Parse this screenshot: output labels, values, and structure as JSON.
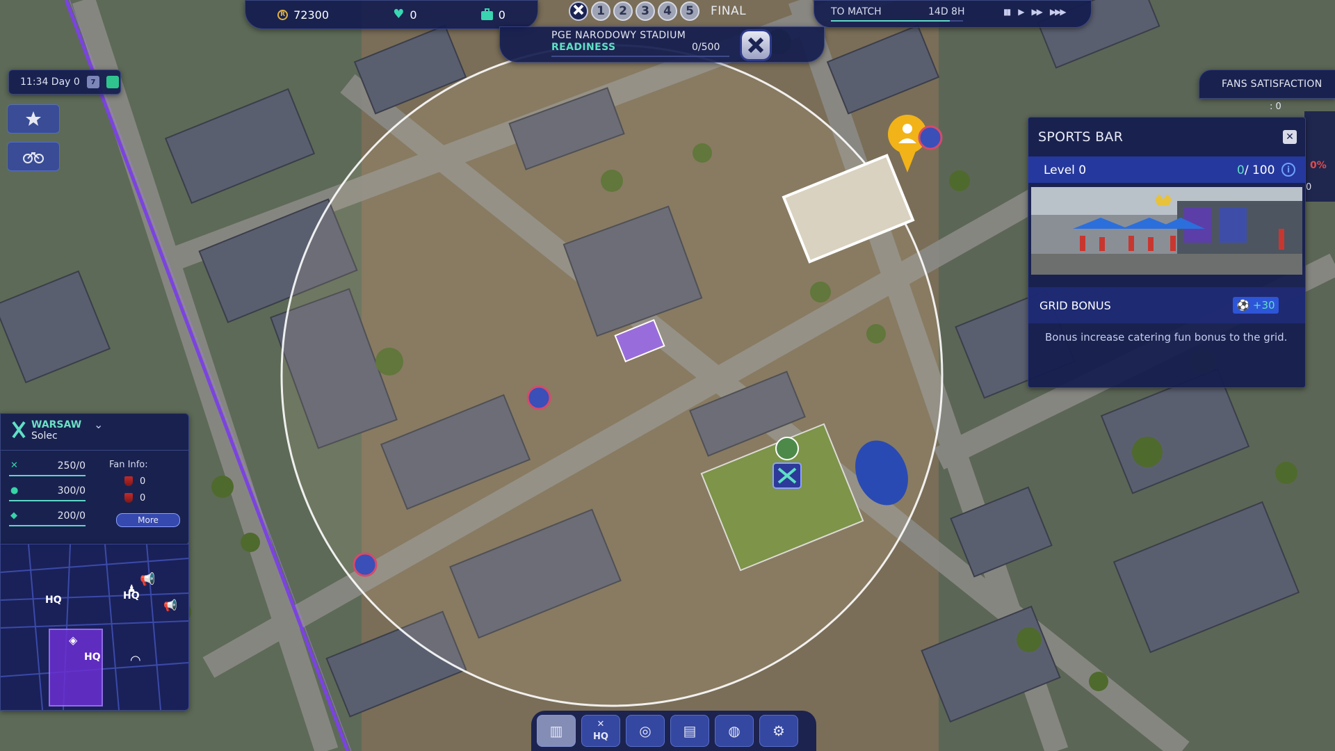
{
  "resources": {
    "coins": "72300",
    "hearts": "0",
    "cases": "0"
  },
  "rounds": {
    "items": [
      "1",
      "2",
      "3",
      "4",
      "5"
    ],
    "final_label": "FINAL"
  },
  "match": {
    "label": "TO MATCH",
    "time": "14D 8H",
    "progress_fraction": 0.9
  },
  "stadium": {
    "name": "PGE NARODOWY STADIUM",
    "status": "READINESS",
    "value": "0/500",
    "progress_fraction": 0
  },
  "clock": {
    "time": "11:34 Day 0",
    "calendar_day": "7"
  },
  "city": {
    "name": "WARSAW",
    "district": "Solec",
    "stats": [
      {
        "icon": "tools-icon",
        "value": "250/0"
      },
      {
        "icon": "ball-icon",
        "value": "300/0"
      },
      {
        "icon": "shield-icon",
        "value": "200/0"
      }
    ],
    "fan_info_label": "Fan Info:",
    "fan_values": [
      "0",
      "0"
    ],
    "more_label": "More"
  },
  "minimap": {
    "labels": [
      "HQ",
      "HQ",
      "HQ"
    ]
  },
  "fans": {
    "label": "FANS SATISFACTION",
    "value": ": 0",
    "side_pct": "0%",
    "side_zero": "0"
  },
  "sports_bar": {
    "title": "SPORTS BAR",
    "close_label": "✕",
    "level_label": "Level 0",
    "level_current": "0",
    "level_max": "/ 100",
    "info_label": "i",
    "grid_bonus_label": "GRID BONUS",
    "grid_bonus_value": "+30",
    "description": "Bonus increase catering  fun bonus to the grid."
  },
  "toolbar": {
    "hq_label": "HQ",
    "buttons": [
      "stats-icon",
      "hq-icon",
      "stadium-icon",
      "map-icon",
      "globe-icon",
      "settings-icon"
    ]
  },
  "colors": {
    "accent": "#5fe0c5",
    "panel": "#141c4e",
    "pin": "#f1b318",
    "district": "#6a2fd1"
  }
}
